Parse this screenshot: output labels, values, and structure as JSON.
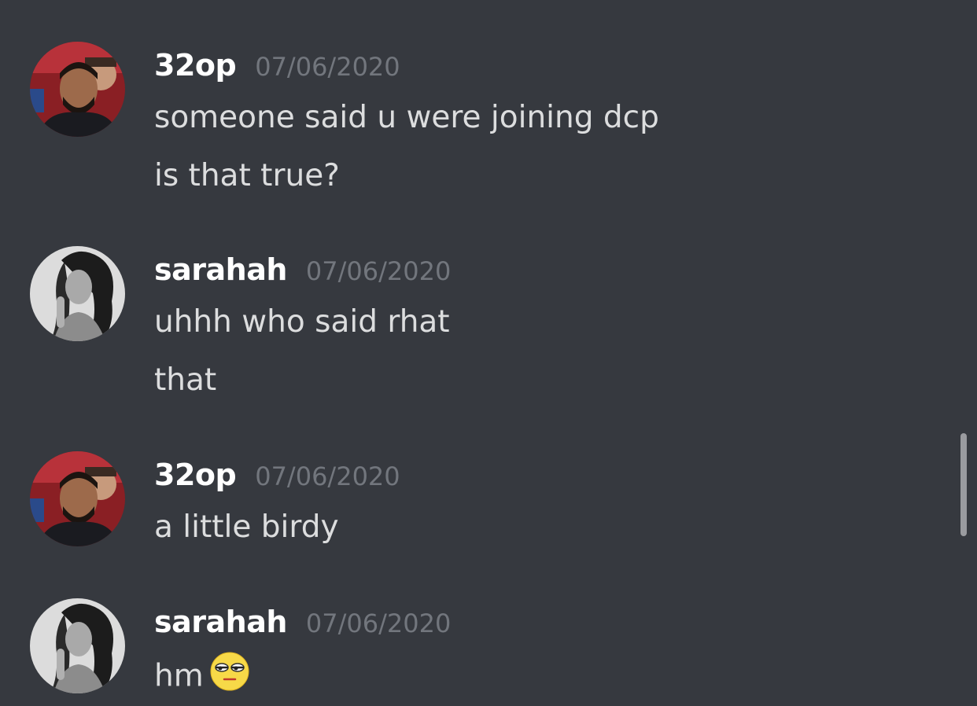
{
  "messages": [
    {
      "username": "32op",
      "timestamp": "07/06/2020",
      "avatar_icon": "avatar-man-icon",
      "lines": [
        "someone said u were joining dcp",
        "is that true?"
      ]
    },
    {
      "username": "sarahah",
      "timestamp": "07/06/2020",
      "avatar_icon": "avatar-woman-icon",
      "lines": [
        "uhhh who said rhat",
        "that"
      ]
    },
    {
      "username": "32op",
      "timestamp": "07/06/2020",
      "avatar_icon": "avatar-man-icon",
      "lines": [
        "a little birdy"
      ]
    },
    {
      "username": "sarahah",
      "timestamp": "07/06/2020",
      "avatar_icon": "avatar-woman-icon",
      "lines": [
        "hm"
      ],
      "emoji": "unamused-face-icon"
    }
  ],
  "colors": {
    "background": "#36393f",
    "username": "#ffffff",
    "timestamp": "#72767d",
    "message_text": "#dcddde",
    "scrollbar": "#9a9b9f"
  }
}
